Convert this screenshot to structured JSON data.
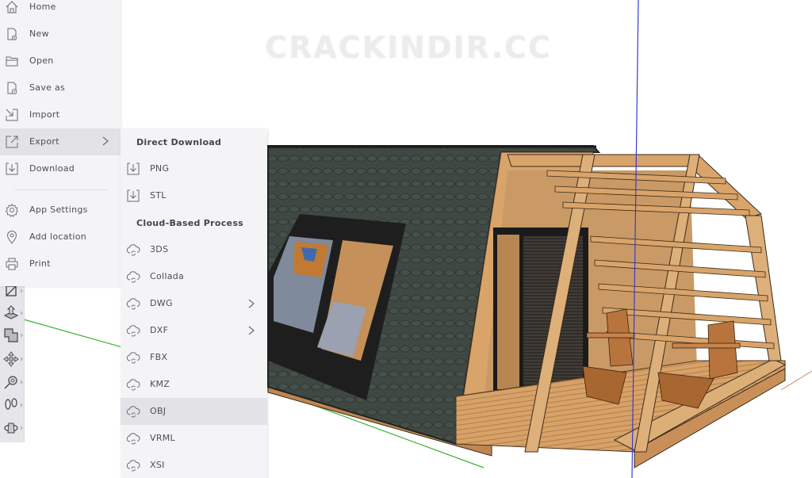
{
  "viewport": {
    "watermark": "CRACKINDIR.CC",
    "axis_colors": {
      "red": "#c8875a",
      "green": "#3bb33b",
      "blue": "#3a3ad0"
    }
  },
  "main_menu": {
    "items": [
      {
        "label": "Home",
        "icon": "home-icon"
      },
      {
        "label": "New",
        "icon": "new-file-icon"
      },
      {
        "label": "Open",
        "icon": "folder-icon"
      },
      {
        "label": "Save as",
        "icon": "save-as-icon"
      },
      {
        "label": "Import",
        "icon": "import-icon"
      },
      {
        "label": "Export",
        "icon": "export-icon",
        "has_submenu": true,
        "active": true
      },
      {
        "label": "Download",
        "icon": "download-icon"
      },
      {
        "label": "App Settings",
        "icon": "gear-icon"
      },
      {
        "label": "Add location",
        "icon": "location-pin-icon"
      },
      {
        "label": "Print",
        "icon": "printer-icon"
      }
    ]
  },
  "export_submenu": {
    "direct_header": "Direct Download",
    "direct_items": [
      {
        "label": "PNG",
        "icon": "download-icon"
      },
      {
        "label": "STL",
        "icon": "download-icon"
      }
    ],
    "cloud_header": "Cloud-Based Process",
    "cloud_items": [
      {
        "label": "3DS",
        "icon": "cloud-sync-icon"
      },
      {
        "label": "Collada",
        "icon": "cloud-sync-icon"
      },
      {
        "label": "DWG",
        "icon": "cloud-sync-icon",
        "has_submenu": true
      },
      {
        "label": "DXF",
        "icon": "cloud-sync-icon",
        "has_submenu": true
      },
      {
        "label": "FBX",
        "icon": "cloud-sync-icon"
      },
      {
        "label": "KMZ",
        "icon": "cloud-sync-icon"
      },
      {
        "label": "OBJ",
        "icon": "cloud-sync-icon",
        "hovered": true
      },
      {
        "label": "VRML",
        "icon": "cloud-sync-icon"
      },
      {
        "label": "XSI",
        "icon": "cloud-sync-icon"
      }
    ]
  },
  "toolstrip": {
    "tools": [
      {
        "name": "rectangle-tool-icon"
      },
      {
        "name": "push-pull-tool-icon"
      },
      {
        "name": "offset-tool-icon"
      },
      {
        "name": "move-tool-icon"
      },
      {
        "name": "tape-measure-tool-icon"
      },
      {
        "name": "walk-tool-icon"
      },
      {
        "name": "orbit-tool-icon"
      }
    ]
  },
  "colors": {
    "menu_bg": "#f4f4f6",
    "menu_active_bg": "#e3e3e7",
    "menu_text": "#4d4d52",
    "roof_shingle": "#3c4540",
    "wood": "#d9a46a"
  }
}
